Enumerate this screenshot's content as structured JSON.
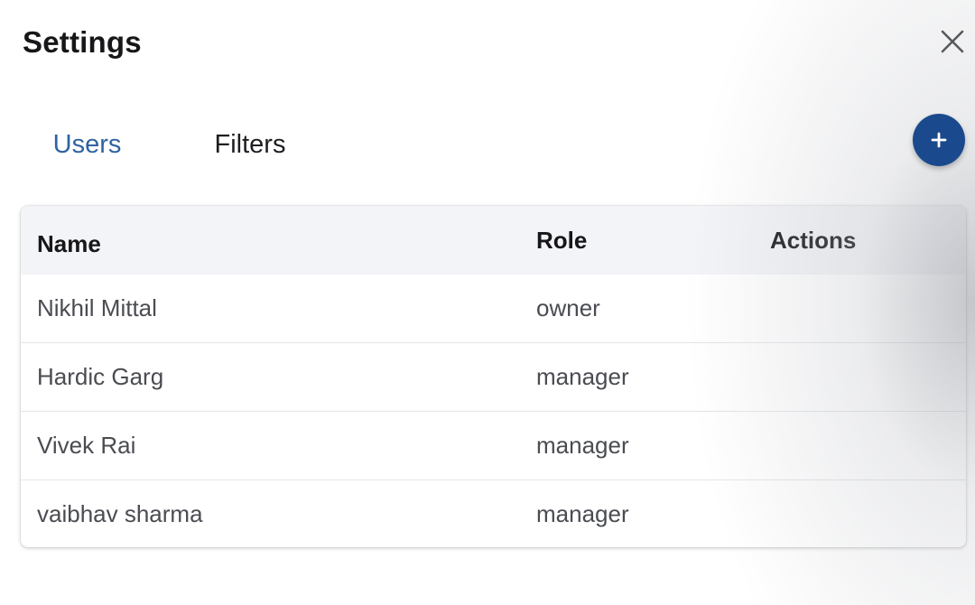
{
  "header": {
    "title": "Settings",
    "close_icon": "close-icon"
  },
  "tabs": [
    {
      "label": "Users",
      "active": true
    },
    {
      "label": "Filters",
      "active": false
    }
  ],
  "add_button": {
    "icon": "plus-icon"
  },
  "table": {
    "columns": [
      "Name",
      "Role",
      "Actions"
    ],
    "rows": [
      {
        "name": "Nikhil Mittal",
        "role": "owner"
      },
      {
        "name": "Hardic Garg",
        "role": "manager"
      },
      {
        "name": "Vivek Rai",
        "role": "manager"
      },
      {
        "name": "vaibhav sharma",
        "role": "manager"
      }
    ]
  },
  "colors": {
    "accent": "#2f63a2",
    "fab": "#1a4a8d",
    "header_bg": "#f3f4f7"
  }
}
